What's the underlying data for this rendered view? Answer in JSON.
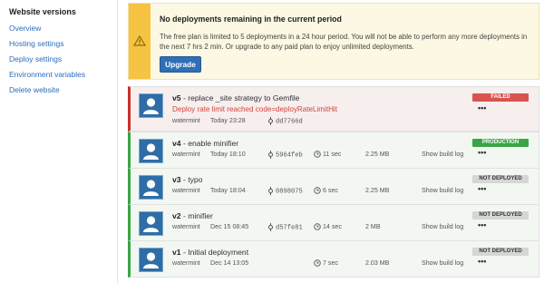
{
  "sidebar": {
    "title": "Website versions",
    "links": [
      "Overview",
      "Hosting settings",
      "Deploy settings",
      "Environment variables",
      "Delete website"
    ]
  },
  "alert": {
    "title": "No deployments remaining in the current period",
    "text": "The free plan is limited to 5 deployments in a 24 hour period. You will not be able to perform any more deployments in the next 7 hrs 2 min. Or upgrade to any paid plan to enjoy unlimited deployments.",
    "button": "Upgrade",
    "icon": "warning-icon",
    "accent": "#f6c342"
  },
  "deploys": [
    {
      "version": "v5",
      "message": "- replace _site strategy to Gemfile",
      "error": "Deploy rate limit reached code=deployRateLimitHit",
      "user": "watermint",
      "time": "Today 23:28",
      "commit": "dd7766d",
      "duration": "",
      "size": "",
      "build_log": "",
      "status": "FAILED",
      "more": "•••"
    },
    {
      "version": "v4",
      "message": "- enable minifier",
      "error": "",
      "user": "watermint",
      "time": "Today 18:10",
      "commit": "5964feb",
      "duration": "11 sec",
      "size": "2.25 MB",
      "build_log": "Show build log",
      "status": "PRODUCTION",
      "more": "•••"
    },
    {
      "version": "v3",
      "message": "- typo",
      "error": "",
      "user": "watermint",
      "time": "Today 18:04",
      "commit": "0898075",
      "duration": "6 sec",
      "size": "2.25 MB",
      "build_log": "Show build log",
      "status": "NOT DEPLOYED",
      "more": "•••"
    },
    {
      "version": "v2",
      "message": "- minifier",
      "error": "",
      "user": "watermint",
      "time": "Dec 15 08:45",
      "commit": "d57fe81",
      "duration": "14 sec",
      "size": "2 MB",
      "build_log": "Show build log",
      "status": "NOT DEPLOYED",
      "more": "•••"
    },
    {
      "version": "v1",
      "message": "- Initial deployment",
      "error": "",
      "user": "watermint",
      "time": "Dec 14 13:05",
      "commit": "",
      "duration": "7 sec",
      "size": "2.03 MB",
      "build_log": "Show build log",
      "status": "NOT DEPLOYED",
      "more": "•••"
    }
  ],
  "colors": {
    "failed": "#d9534f",
    "production": "#3aa544",
    "link": "#2a6ebb"
  }
}
